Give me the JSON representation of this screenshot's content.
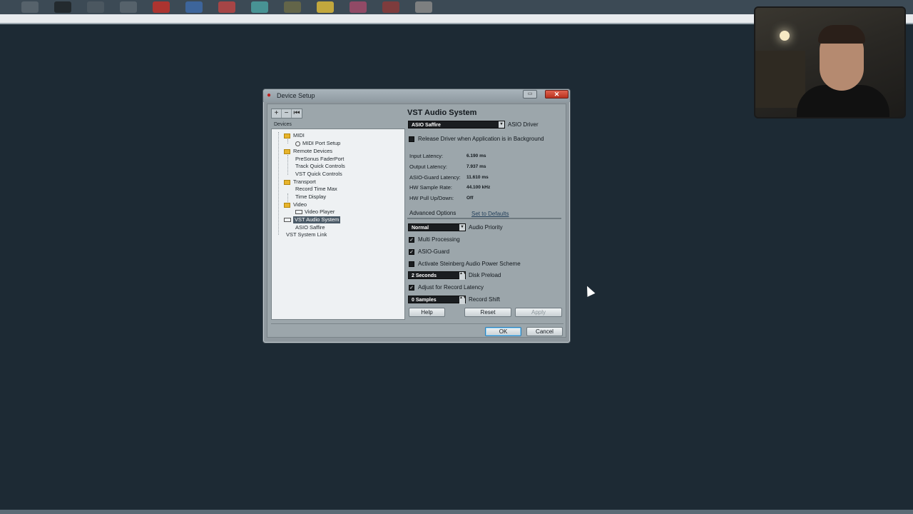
{
  "dialog": {
    "title": "Device Setup",
    "close_glyph": "✕",
    "restore_glyph": "▭"
  },
  "toolbar": {
    "add": "+",
    "remove": "−",
    "reset": "⏮"
  },
  "devices_label": "Devices",
  "tree": [
    {
      "label": "MIDI",
      "icon": "folder-icon",
      "level": 1
    },
    {
      "label": "MIDI Port Setup",
      "icon": "midi-port-icon",
      "level": 2
    },
    {
      "label": "Remote Devices",
      "icon": "folder-icon",
      "level": 1
    },
    {
      "label": "PreSonus FaderPort",
      "icon": "",
      "level": 2
    },
    {
      "label": "Track Quick Controls",
      "icon": "",
      "level": 2
    },
    {
      "label": "VST Quick Controls",
      "icon": "",
      "level": 2
    },
    {
      "label": "Transport",
      "icon": "folder-icon",
      "level": 1
    },
    {
      "label": "Record Time Max",
      "icon": "",
      "level": 2
    },
    {
      "label": "Time Display",
      "icon": "",
      "level": 2
    },
    {
      "label": "Video",
      "icon": "folder-icon",
      "level": 1
    },
    {
      "label": "Video Player",
      "icon": "video-icon",
      "level": 2
    },
    {
      "label": "VST Audio System",
      "icon": "audio-system-icon",
      "level": 1,
      "selected": true
    },
    {
      "label": "ASIO Saffire",
      "icon": "",
      "level": 2
    },
    {
      "label": "VST System Link",
      "icon": "",
      "level": 0
    }
  ],
  "panel": {
    "title": "VST Audio System",
    "driver": {
      "value": "ASIO Saffire",
      "label": "ASIO Driver"
    },
    "release_driver": {
      "checked": false,
      "label": "Release Driver when Application is in Background"
    },
    "info": [
      {
        "label": "Input Latency:",
        "value": "6.190 ms"
      },
      {
        "label": "Output Latency:",
        "value": "7.937 ms"
      },
      {
        "label": "ASIO-Guard Latency:",
        "value": "11.610 ms"
      },
      {
        "label": "HW Sample Rate:",
        "value": "44.100 kHz"
      },
      {
        "label": "HW Pull Up/Down:",
        "value": "Off"
      }
    ],
    "advanced_label": "Advanced Options",
    "defaults_label": "Set to Defaults",
    "audio_priority": {
      "value": "Normal",
      "label": "Audio Priority"
    },
    "multi_processing": {
      "checked": true,
      "label": "Multi Processing"
    },
    "asio_guard": {
      "checked": true,
      "label": "ASIO-Guard"
    },
    "power_scheme": {
      "checked": false,
      "label": "Activate Steinberg Audio Power Scheme"
    },
    "disk_preload": {
      "value": "2 Seconds",
      "label": "Disk Preload"
    },
    "adjust_latency": {
      "checked": true,
      "label": "Adjust for Record Latency"
    },
    "record_shift": {
      "value": "0 Samples",
      "label": "Record Shift"
    }
  },
  "buttons": {
    "help": "Help",
    "reset": "Reset",
    "apply": "Apply",
    "ok": "OK",
    "cancel": "Cancel"
  },
  "check_glyph": "✓",
  "dropdown_glyph": "▾",
  "spin_glyph": "▲▼"
}
